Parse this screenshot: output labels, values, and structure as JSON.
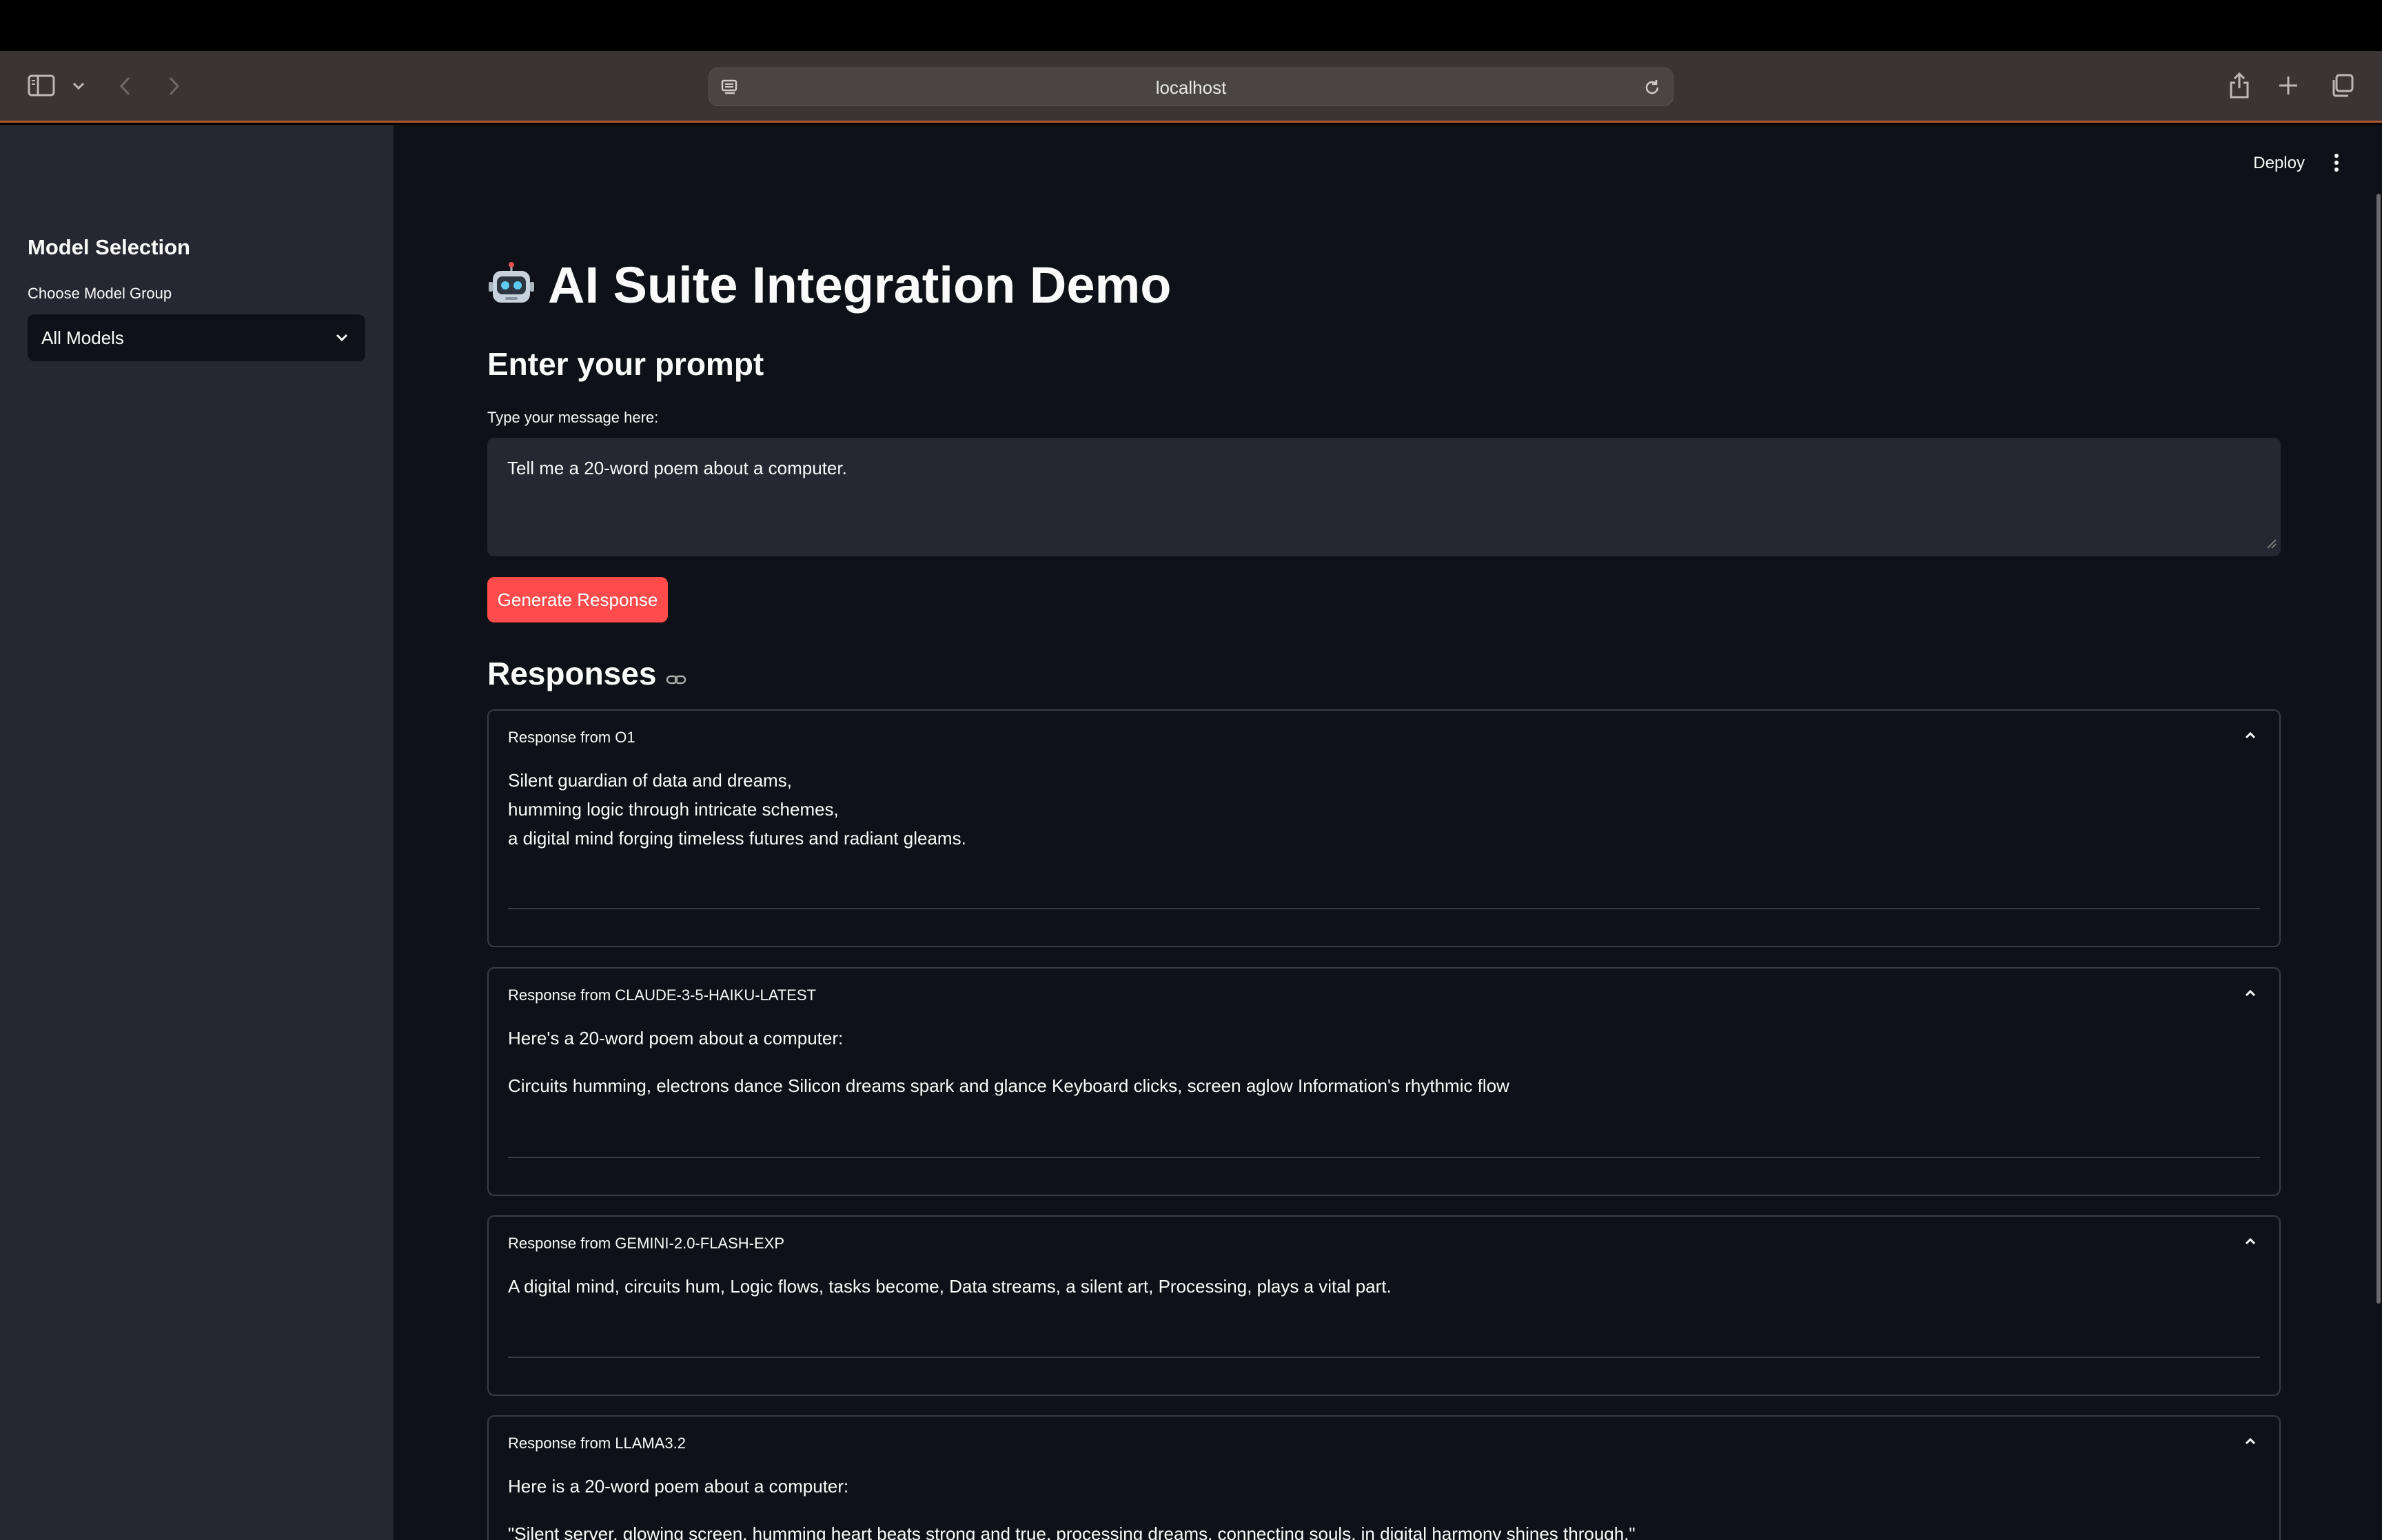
{
  "browser": {
    "url": "localhost"
  },
  "sidebar": {
    "title": "Model Selection",
    "group_label": "Choose Model Group",
    "group_value": "All Models"
  },
  "header": {
    "deploy_label": "Deploy"
  },
  "main": {
    "title": "AI Suite Integration Demo",
    "prompt_heading": "Enter your prompt",
    "input_label": "Type your message here:",
    "input_value": "Tell me a 20-word poem about a computer.",
    "generate_label": "Generate Response",
    "responses_heading": "Responses"
  },
  "responses": [
    {
      "label": "Response from O1",
      "lines": [
        "Silent guardian of data and dreams,",
        "humming logic through intricate schemes,",
        "a digital mind forging timeless futures and radiant gleams."
      ]
    },
    {
      "label": "Response from CLAUDE-3-5-HAIKU-LATEST",
      "lines": [
        "Here's a 20-word poem about a computer:",
        "Circuits humming, electrons dance Silicon dreams spark and glance Keyboard clicks, screen aglow Information's rhythmic flow"
      ]
    },
    {
      "label": "Response from GEMINI-2.0-FLASH-EXP",
      "lines": [
        "A digital mind, circuits hum, Logic flows, tasks become, Data streams, a silent art, Processing, plays a vital part."
      ]
    },
    {
      "label": "Response from LLAMA3.2",
      "lines": [
        "Here is a 20-word poem about a computer:",
        "\"Silent server, glowing screen, humming heart beats strong and true, processing dreams, connecting souls, in digital harmony shines through.\""
      ]
    }
  ]
}
